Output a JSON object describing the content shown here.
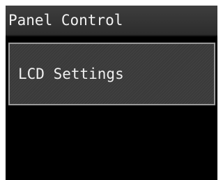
{
  "header": {
    "title": "Panel Control"
  },
  "menu": {
    "items": [
      {
        "label": "LCD Settings"
      }
    ]
  },
  "colors": {
    "screen_background": "#000000",
    "title_bar": "#353535",
    "button_border": "#9a9a9a",
    "button_background": "#3a3a3a",
    "text": "#f2f2f2"
  }
}
